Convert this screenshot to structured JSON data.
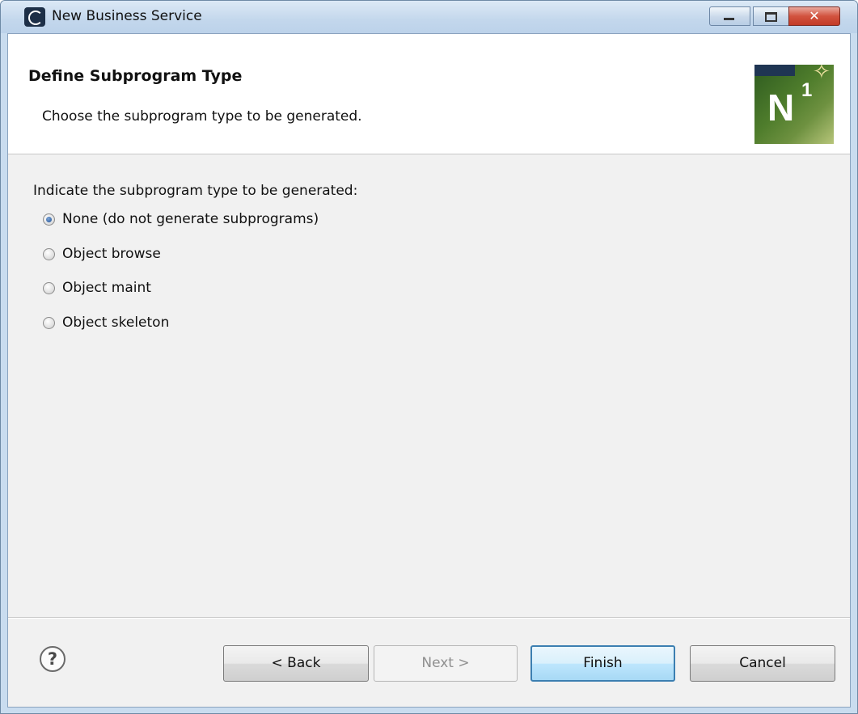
{
  "window": {
    "title": "New Business Service",
    "close_glyph": "✕"
  },
  "header": {
    "title": "Define Subprogram Type",
    "description": "Choose the subprogram type to be generated.",
    "logo": {
      "letter": "N",
      "superscript": "1",
      "icon": "natural-one-logo"
    }
  },
  "body": {
    "prompt": "Indicate the subprogram type to be generated:",
    "options": [
      {
        "label": "None (do not generate subprograms)",
        "checked": true
      },
      {
        "label": "Object browse",
        "checked": false
      },
      {
        "label": "Object maint",
        "checked": false
      },
      {
        "label": "Object skeleton",
        "checked": false
      }
    ]
  },
  "footer": {
    "help_glyph": "?",
    "back_label": "< Back",
    "next_label": "Next >",
    "finish_label": "Finish",
    "cancel_label": "Cancel",
    "next_enabled": false
  },
  "colors": {
    "titlebar": "#c3d7ec",
    "close_button": "#c23a26",
    "default_button_border": "#3c7fb1",
    "radio_checked": "#1e4f92"
  }
}
